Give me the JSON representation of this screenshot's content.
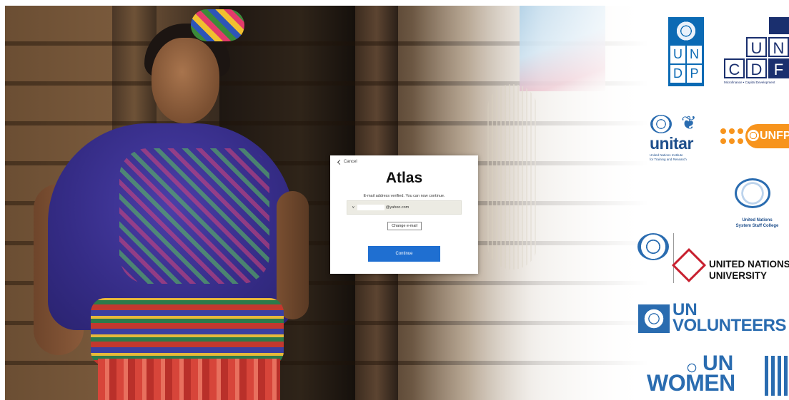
{
  "login": {
    "cancel_label": "Cancel",
    "app_title": "Atlas",
    "status_message": "E-mail address verified. You can now continue.",
    "email_prefix": "v",
    "email_domain": "@yahoo.com",
    "change_email_label": "Change e-mail",
    "continue_label": "Continue"
  },
  "logos": {
    "undp_letters": [
      "U",
      "N",
      "D",
      "P"
    ],
    "uncdf_letters": [
      "U",
      "N",
      "C",
      "D",
      "F"
    ],
    "uncdf_tagline": "Microfinance • Capital Development",
    "unitar_name": "unitar",
    "unitar_sub1": "United Nations Institute",
    "unitar_sub2": "for Training and Research",
    "unfpa_name": "UNFPA",
    "unssc_line1": "United Nations",
    "unssc_line2": "System Staff College",
    "unu_line1": "UNITED NATIONS",
    "unu_line2": "UNIVERSITY",
    "unv_line1": "UN",
    "unv_line2": "VOLUNTEERS",
    "unwomen_line1": "UN",
    "unwomen_line2": "WOMEN"
  },
  "colors": {
    "continue_button": "#1f6fd1",
    "undp_blue": "#0b6ab4",
    "unfpa_orange": "#f7941d",
    "un_blue": "#2a6cb0",
    "unu_red": "#c8202f"
  }
}
